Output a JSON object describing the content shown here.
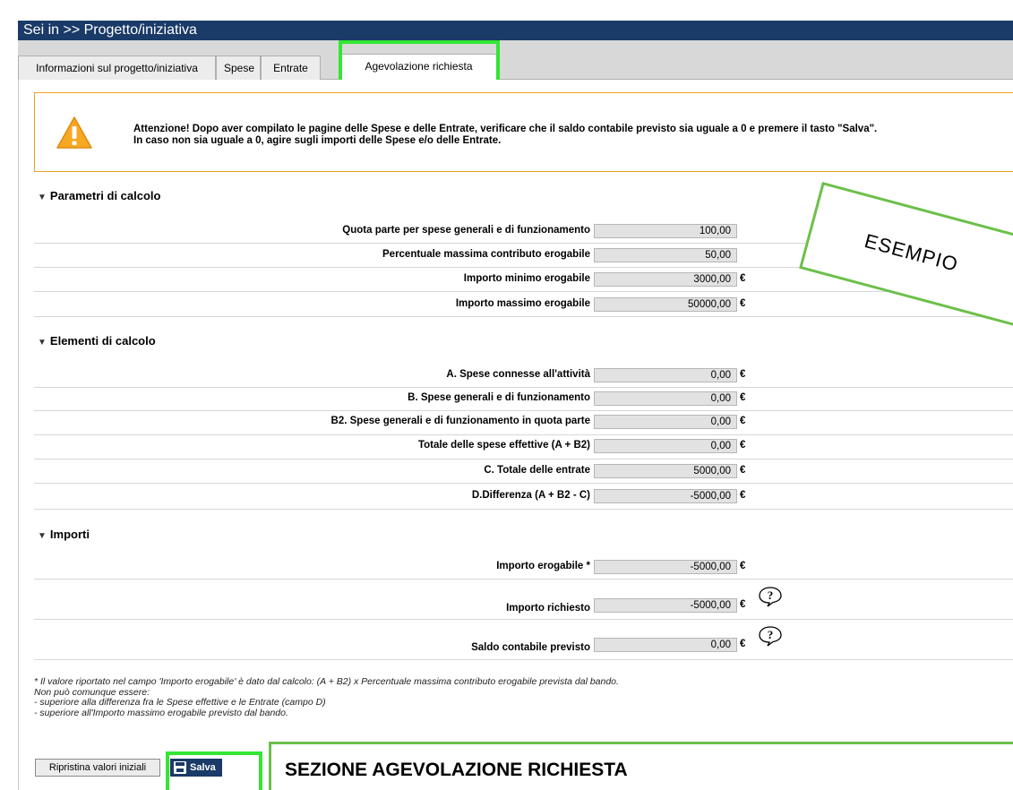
{
  "breadcrumb": "Sei in >> Progetto/iniziativa",
  "tabs": [
    {
      "label": "Informazioni sul progetto/iniziativa"
    },
    {
      "label": "Spese"
    },
    {
      "label": "Entrate"
    },
    {
      "label": "Agevolazione richiesta"
    }
  ],
  "alert": {
    "line1": "Attenzione! Dopo aver compilato le pagine delle Spese e delle Entrate, verificare che il saldo contabile previsto sia uguale a 0 e premere il tasto \"Salva\".",
    "line2": "In caso non sia uguale a 0, agire sugli importi delle Spese e/o delle Entrate."
  },
  "sections": [
    {
      "title": "Parametri di calcolo",
      "rows": [
        {
          "label": "Quota parte per spese generali e di funzionamento",
          "value": "100,00",
          "unit": ""
        },
        {
          "label": "Percentuale massima contributo erogabile",
          "value": "50,00",
          "unit": ""
        },
        {
          "label": "Importo minimo erogabile",
          "value": "3000,00",
          "unit": "€"
        },
        {
          "label": "Importo massimo erogabile",
          "value": "50000,00",
          "unit": "€"
        }
      ]
    },
    {
      "title": "Elementi di calcolo",
      "rows": [
        {
          "label": "A. Spese connesse all'attività",
          "value": "0,00",
          "unit": "€"
        },
        {
          "label": "B. Spese generali e di funzionamento",
          "value": "0,00",
          "unit": "€"
        },
        {
          "label": "B2. Spese generali e di funzionamento in quota parte",
          "value": "0,00",
          "unit": "€"
        },
        {
          "label": "Totale delle spese effettive (A + B2)",
          "value": "0,00",
          "unit": "€"
        },
        {
          "label": "C. Totale delle entrate",
          "value": "5000,00",
          "unit": "€"
        },
        {
          "label": "D.Differenza (A + B2 - C)",
          "value": "-5000,00",
          "unit": "€"
        }
      ]
    },
    {
      "title": "Importi",
      "rows": [
        {
          "label": "Importo erogabile *",
          "value": "-5000,00",
          "unit": "€"
        },
        {
          "label": "Importo richiesto",
          "value": "-5000,00",
          "unit": "€"
        },
        {
          "label": "Saldo contabile previsto",
          "value": "0,00",
          "unit": "€"
        }
      ]
    }
  ],
  "footnote": [
    "* Il valore riportato nel campo 'Importo erogabile' è dato dal calcolo: (A + B2) x Percentuale massima contributo erogabile prevista dal bando.",
    "Non può comunque essere:",
    "- superiore alla differenza fra le Spese effettive e le Entrate (campo D)",
    "- superiore all'Importo massimo erogabile previsto dal bando."
  ],
  "buttons": {
    "reset": "Ripristina valori iniziali",
    "save": "Salva"
  },
  "annotations": {
    "esempio": "ESEMPIO",
    "section_callout": "SEZIONE AGEVOLAZIONE RICHIESTA"
  },
  "colors": {
    "header_bg": "#1a3a67",
    "highlight": "#33e633",
    "alert_border": "#f0a020"
  }
}
